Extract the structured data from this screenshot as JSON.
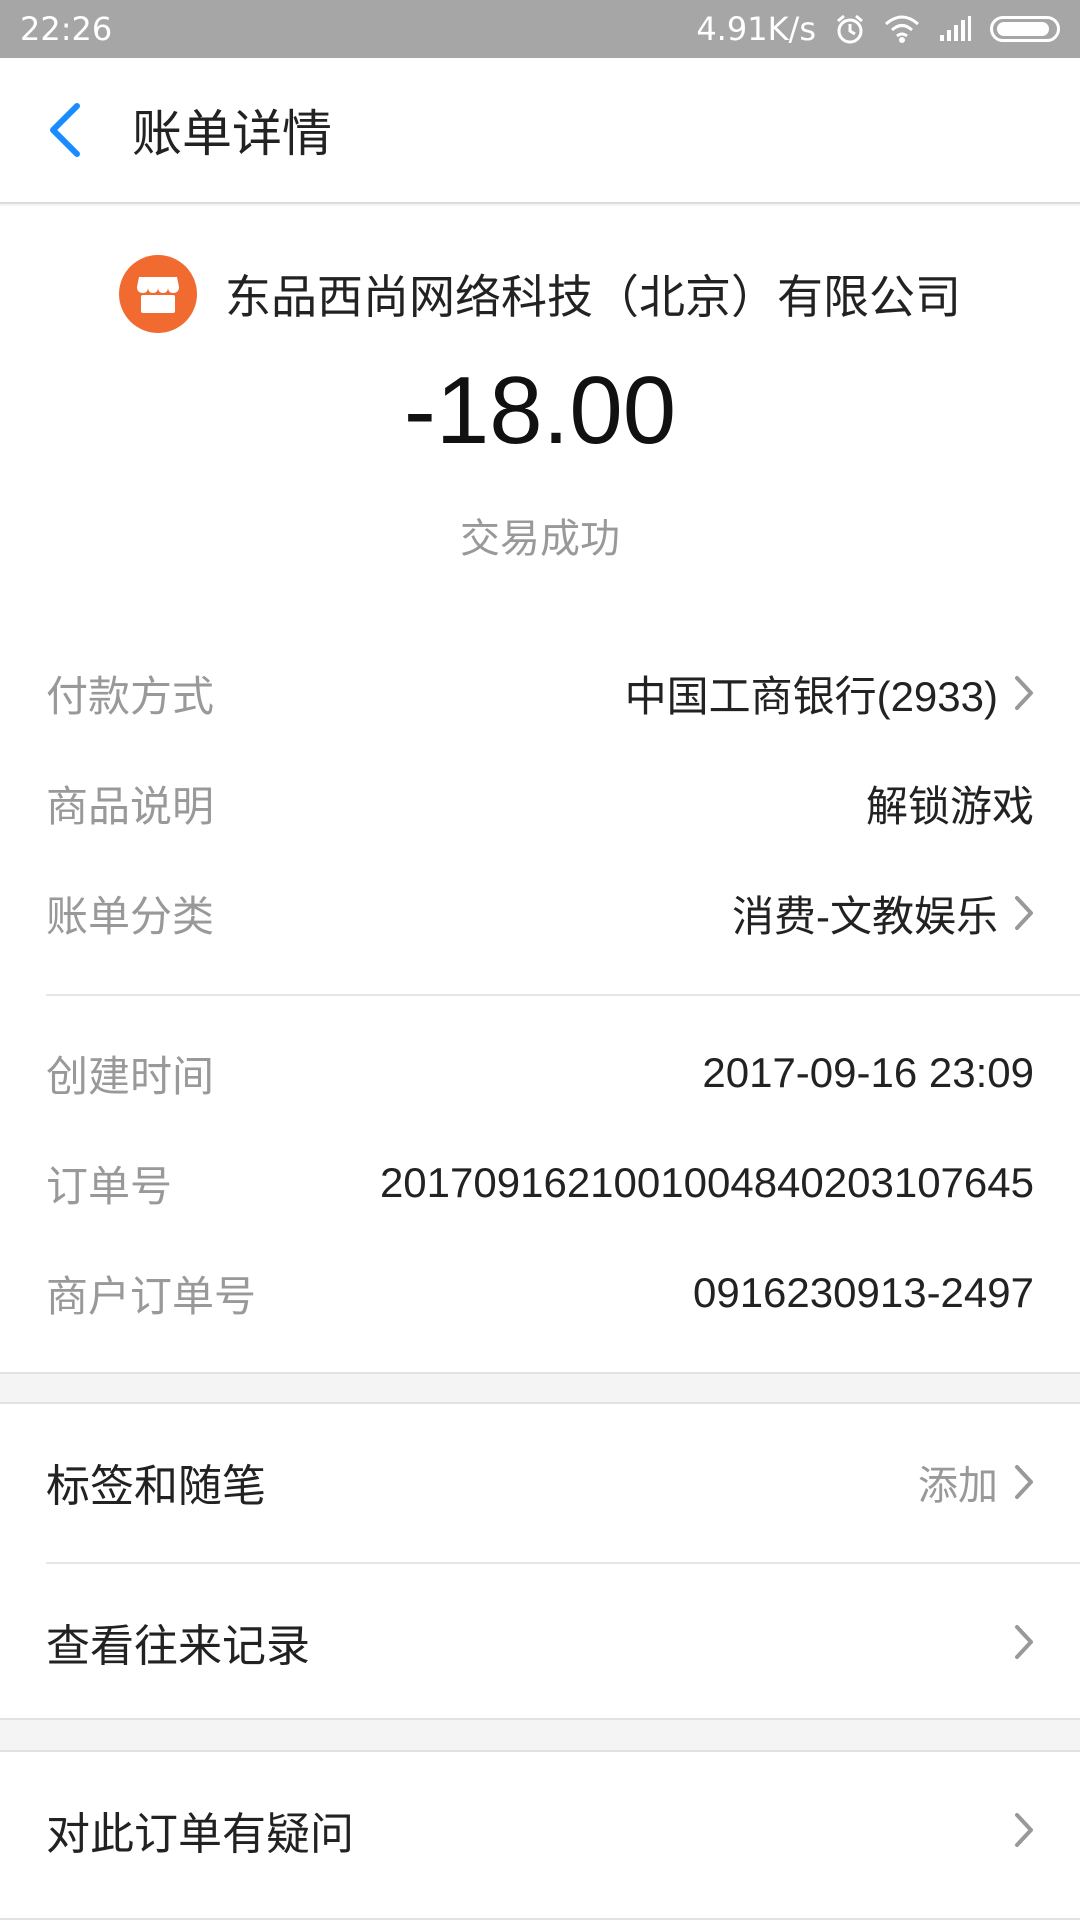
{
  "status_bar": {
    "time": "22:26",
    "net_speed": "4.91K/s"
  },
  "header": {
    "title": "账单详情"
  },
  "merchant": {
    "name": "东品西尚网络科技（北京）有限公司",
    "logo_color": "#f16a2f"
  },
  "transaction": {
    "amount": "-18.00",
    "status": "交易成功"
  },
  "details": [
    {
      "label": "付款方式",
      "value": "中国工商银行(2933)"
    },
    {
      "label": "商品说明",
      "value": "解锁游戏"
    },
    {
      "label": "账单分类",
      "value": "消费-文教娱乐"
    }
  ],
  "meta": [
    {
      "label": "创建时间",
      "value": "2017-09-16 23:09"
    },
    {
      "label": "订单号",
      "value": "20170916210010048402031076​45"
    },
    {
      "label": "商户订单号",
      "value": "0916230913-2497"
    }
  ],
  "actions": {
    "tags_label": "标签和随笔",
    "tags_hint": "添加",
    "history_label": "查看往来记录",
    "dispute_label": "对此订单有疑问"
  },
  "colors": {
    "accent": "#1a8cff",
    "label_gray": "#999999"
  }
}
